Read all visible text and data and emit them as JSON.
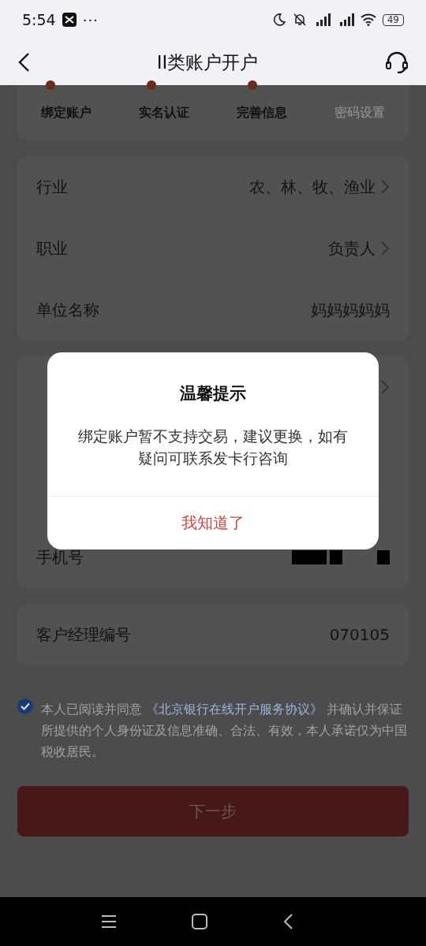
{
  "status_bar": {
    "time": "5:54",
    "dots": "···",
    "battery": "49"
  },
  "header": {
    "title": "II类账户开户"
  },
  "steps": [
    {
      "label": "绑定账户",
      "done": true
    },
    {
      "label": "实名认证",
      "done": true
    },
    {
      "label": "完善信息",
      "done": true
    },
    {
      "label": "密码设置",
      "done": false
    }
  ],
  "form_groups": [
    {
      "rows": [
        {
          "label": "行业",
          "value": "农、林、牧、渔业",
          "chevron": true,
          "kind": "text"
        },
        {
          "label": "职业",
          "value": "负责人",
          "chevron": true,
          "kind": "text"
        },
        {
          "label": "单位名称",
          "value": "妈妈妈妈妈",
          "chevron": false,
          "kind": "text"
        }
      ]
    },
    {
      "rows": [
        {
          "chevron": true,
          "kind": "covered"
        },
        {
          "label": "手机号",
          "chevron": false,
          "kind": "redacted"
        }
      ]
    },
    {
      "rows": [
        {
          "label": "客户经理编号",
          "value": "070105",
          "chevron": false,
          "kind": "text"
        }
      ]
    }
  ],
  "agreement": {
    "checked": true,
    "text_before": "本人已阅读并同意",
    "link": "《北京银行在线开户服务协议》",
    "text_after": "并确认并保证所提供的个人身份证及信息准确、合法、有效，本人承诺仅为中国税收居民。"
  },
  "next_button": {
    "label": "下一步"
  },
  "dialog": {
    "title": "温馨提示",
    "message": "绑定账户暂不支持交易，建议更换，如有疑问可联系发卡行咨询",
    "button": "我知道了"
  }
}
